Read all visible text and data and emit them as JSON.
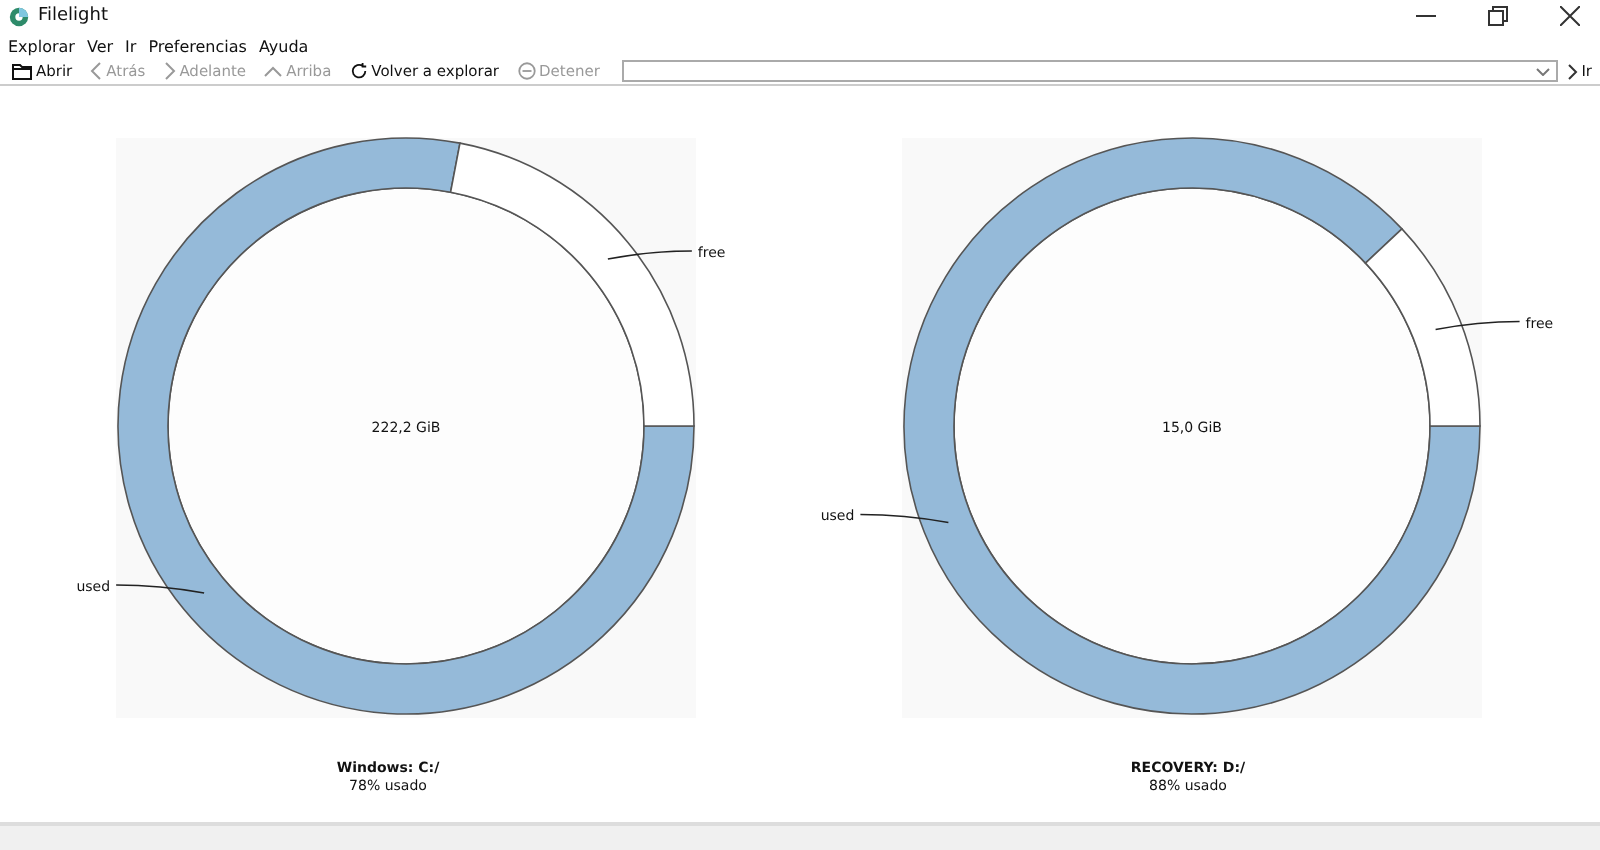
{
  "window": {
    "title": "Filelight"
  },
  "menu": [
    "Explorar",
    "Ver",
    "Ir",
    "Preferencias",
    "Ayuda"
  ],
  "toolbar": [
    {
      "label": "Abrir",
      "disabled": false
    },
    {
      "label": "Atrás",
      "disabled": true
    },
    {
      "label": "Adelante",
      "disabled": true
    },
    {
      "label": "Arriba",
      "disabled": true
    },
    {
      "label": "Volver a explorar",
      "disabled": false
    },
    {
      "label": "Detener",
      "disabled": true
    }
  ],
  "go_button": {
    "label": "Ir"
  },
  "disks": [
    {
      "name": "Windows: C:/",
      "usage": "78% usado",
      "size": "222,2 GiB",
      "chart_data": {
        "type": "donut",
        "categories": [
          "used",
          "free"
        ],
        "values": [
          78,
          22
        ]
      }
    },
    {
      "name": "RECOVERY: D:/",
      "usage": "88% usado",
      "size": "15,0 GiB",
      "chart_data": {
        "type": "donut",
        "categories": [
          "used",
          "free"
        ],
        "values": [
          88,
          12
        ]
      }
    }
  ]
}
